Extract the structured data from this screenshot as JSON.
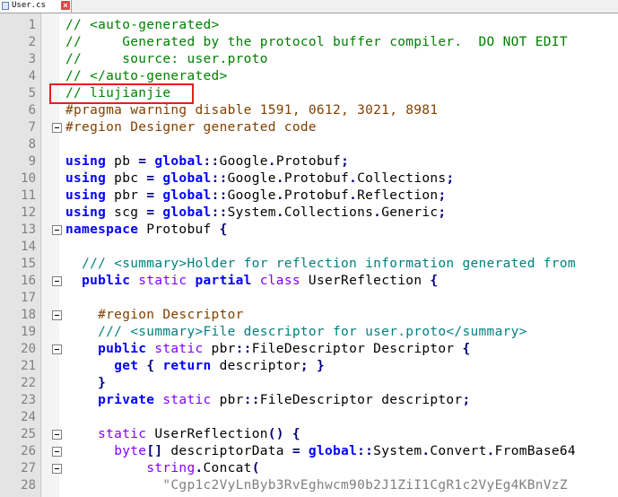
{
  "tab": {
    "label": "User.cs"
  },
  "editor": {
    "lines": [
      {
        "n": "1",
        "segs": [
          [
            "comment",
            "// <auto-generated>"
          ]
        ]
      },
      {
        "n": "2",
        "segs": [
          [
            "comment",
            "//     Generated by the protocol buffer compiler.  DO NOT EDIT"
          ]
        ]
      },
      {
        "n": "3",
        "segs": [
          [
            "comment",
            "//     source: user.proto"
          ]
        ]
      },
      {
        "n": "4",
        "segs": [
          [
            "comment",
            "// </auto-generated>"
          ]
        ]
      },
      {
        "n": "5",
        "segs": [
          [
            "comment",
            "// liujianjie"
          ]
        ]
      },
      {
        "n": "6",
        "segs": [
          [
            "pre",
            "#pragma warning disable 1591, 0612, 3021, 8981"
          ]
        ]
      },
      {
        "n": "7",
        "segs": [
          [
            "pre",
            "#region Designer generated code"
          ]
        ]
      },
      {
        "n": "8",
        "segs": []
      },
      {
        "n": "9",
        "segs": [
          [
            "kw",
            "using"
          ],
          [
            "type",
            " pb "
          ],
          [
            "op",
            "="
          ],
          [
            "type",
            " "
          ],
          [
            "kw",
            "global"
          ],
          [
            "op",
            "::"
          ],
          [
            "type",
            "Google"
          ],
          [
            "op",
            "."
          ],
          [
            "type",
            "Protobuf"
          ],
          [
            "op",
            ";"
          ]
        ]
      },
      {
        "n": "10",
        "segs": [
          [
            "kw",
            "using"
          ],
          [
            "type",
            " pbc "
          ],
          [
            "op",
            "="
          ],
          [
            "type",
            " "
          ],
          [
            "kw",
            "global"
          ],
          [
            "op",
            "::"
          ],
          [
            "type",
            "Google"
          ],
          [
            "op",
            "."
          ],
          [
            "type",
            "Protobuf"
          ],
          [
            "op",
            "."
          ],
          [
            "type",
            "Collections"
          ],
          [
            "op",
            ";"
          ]
        ]
      },
      {
        "n": "11",
        "segs": [
          [
            "kw",
            "using"
          ],
          [
            "type",
            " pbr "
          ],
          [
            "op",
            "="
          ],
          [
            "type",
            " "
          ],
          [
            "kw",
            "global"
          ],
          [
            "op",
            "::"
          ],
          [
            "type",
            "Google"
          ],
          [
            "op",
            "."
          ],
          [
            "type",
            "Protobuf"
          ],
          [
            "op",
            "."
          ],
          [
            "type",
            "Reflection"
          ],
          [
            "op",
            ";"
          ]
        ]
      },
      {
        "n": "12",
        "segs": [
          [
            "kw",
            "using"
          ],
          [
            "type",
            " scg "
          ],
          [
            "op",
            "="
          ],
          [
            "type",
            " "
          ],
          [
            "kw",
            "global"
          ],
          [
            "op",
            "::"
          ],
          [
            "type",
            "System"
          ],
          [
            "op",
            "."
          ],
          [
            "type",
            "Collections"
          ],
          [
            "op",
            "."
          ],
          [
            "type",
            "Generic"
          ],
          [
            "op",
            ";"
          ]
        ]
      },
      {
        "n": "13",
        "segs": [
          [
            "kw",
            "namespace"
          ],
          [
            "type",
            " Protobuf "
          ],
          [
            "op",
            "{"
          ]
        ]
      },
      {
        "n": "14",
        "segs": []
      },
      {
        "n": "15",
        "segs": [
          [
            "type",
            "  "
          ],
          [
            "doc",
            "/// <summary>Holder for reflection information generated from"
          ]
        ]
      },
      {
        "n": "16",
        "segs": [
          [
            "type",
            "  "
          ],
          [
            "kw",
            "public"
          ],
          [
            "type",
            " "
          ],
          [
            "kw2",
            "static"
          ],
          [
            "type",
            " "
          ],
          [
            "kw",
            "partial"
          ],
          [
            "type",
            " "
          ],
          [
            "kw2",
            "class"
          ],
          [
            "type",
            " UserReflection "
          ],
          [
            "op",
            "{"
          ]
        ]
      },
      {
        "n": "17",
        "segs": []
      },
      {
        "n": "18",
        "segs": [
          [
            "type",
            "    "
          ],
          [
            "pre",
            "#region Descriptor"
          ]
        ]
      },
      {
        "n": "19",
        "segs": [
          [
            "type",
            "    "
          ],
          [
            "doc",
            "/// <summary>File descriptor for user.proto</summary>"
          ]
        ]
      },
      {
        "n": "20",
        "segs": [
          [
            "type",
            "    "
          ],
          [
            "kw",
            "public"
          ],
          [
            "type",
            " "
          ],
          [
            "kw2",
            "static"
          ],
          [
            "type",
            " pbr"
          ],
          [
            "op",
            "::"
          ],
          [
            "type",
            "FileDescriptor Descriptor "
          ],
          [
            "op",
            "{"
          ]
        ]
      },
      {
        "n": "21",
        "segs": [
          [
            "type",
            "      "
          ],
          [
            "kw",
            "get"
          ],
          [
            "type",
            " "
          ],
          [
            "op",
            "{"
          ],
          [
            "type",
            " "
          ],
          [
            "kw",
            "return"
          ],
          [
            "type",
            " descriptor"
          ],
          [
            "op",
            ";"
          ],
          [
            "type",
            " "
          ],
          [
            "op",
            "}"
          ]
        ]
      },
      {
        "n": "22",
        "segs": [
          [
            "type",
            "    "
          ],
          [
            "op",
            "}"
          ]
        ]
      },
      {
        "n": "23",
        "segs": [
          [
            "type",
            "    "
          ],
          [
            "kw",
            "private"
          ],
          [
            "type",
            " "
          ],
          [
            "kw2",
            "static"
          ],
          [
            "type",
            " pbr"
          ],
          [
            "op",
            "::"
          ],
          [
            "type",
            "FileDescriptor descriptor"
          ],
          [
            "op",
            ";"
          ]
        ]
      },
      {
        "n": "24",
        "segs": []
      },
      {
        "n": "25",
        "segs": [
          [
            "type",
            "    "
          ],
          [
            "kw2",
            "static"
          ],
          [
            "type",
            " UserReflection"
          ],
          [
            "op",
            "()"
          ],
          [
            "type",
            " "
          ],
          [
            "op",
            "{"
          ]
        ]
      },
      {
        "n": "26",
        "segs": [
          [
            "type",
            "      "
          ],
          [
            "kw2",
            "byte"
          ],
          [
            "op",
            "[]"
          ],
          [
            "type",
            " descriptorData "
          ],
          [
            "op",
            "="
          ],
          [
            "type",
            " "
          ],
          [
            "kw",
            "global"
          ],
          [
            "op",
            "::"
          ],
          [
            "type",
            "System"
          ],
          [
            "op",
            "."
          ],
          [
            "type",
            "Convert"
          ],
          [
            "op",
            "."
          ],
          [
            "type",
            "FromBase64"
          ]
        ]
      },
      {
        "n": "27",
        "segs": [
          [
            "type",
            "          "
          ],
          [
            "kw2",
            "string"
          ],
          [
            "op",
            "."
          ],
          [
            "type",
            "Concat"
          ],
          [
            "op",
            "("
          ]
        ]
      },
      {
        "n": "28",
        "segs": [
          [
            "type",
            "            "
          ],
          [
            "str",
            "\"Cgp1c2VyLnByb3RvEghwcm90b2J1ZiI1CgR1c2VyEg4KBnVzZ"
          ]
        ]
      }
    ]
  }
}
